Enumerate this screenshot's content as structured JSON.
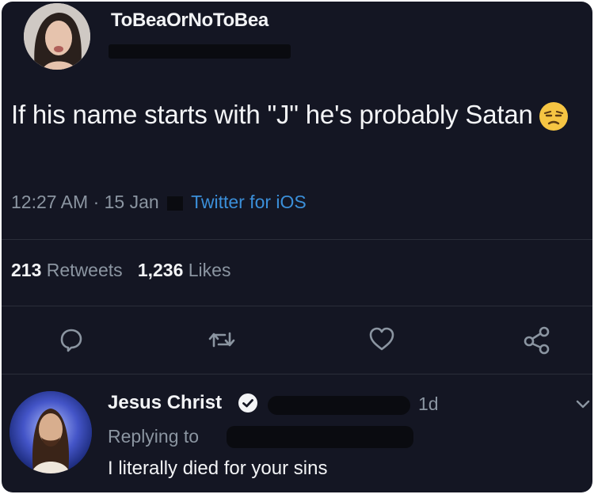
{
  "tweet": {
    "username": "ToBeaOrNoToBea",
    "text": "If his name starts with \"J\" he's probably Satan",
    "emoji": "unamused-face-icon",
    "time": "12:27 AM · 15 Jan",
    "source": "Twitter for iOS",
    "retweets_count": "213",
    "retweets_label": "Retweets",
    "likes_count": "1,236",
    "likes_label": "Likes"
  },
  "actions": [
    "reply-icon",
    "retweet-icon",
    "like-icon",
    "share-icon"
  ],
  "reply": {
    "name": "Jesus Christ",
    "verified_icon": "verified-badge-icon",
    "time": "1d",
    "replying_label": "Replying to",
    "text": "I literally died for your sins"
  },
  "colors": {
    "background": "#141623",
    "text": "#f3f4f6",
    "secondary": "#8b95a1",
    "link": "#3b8fd9"
  }
}
